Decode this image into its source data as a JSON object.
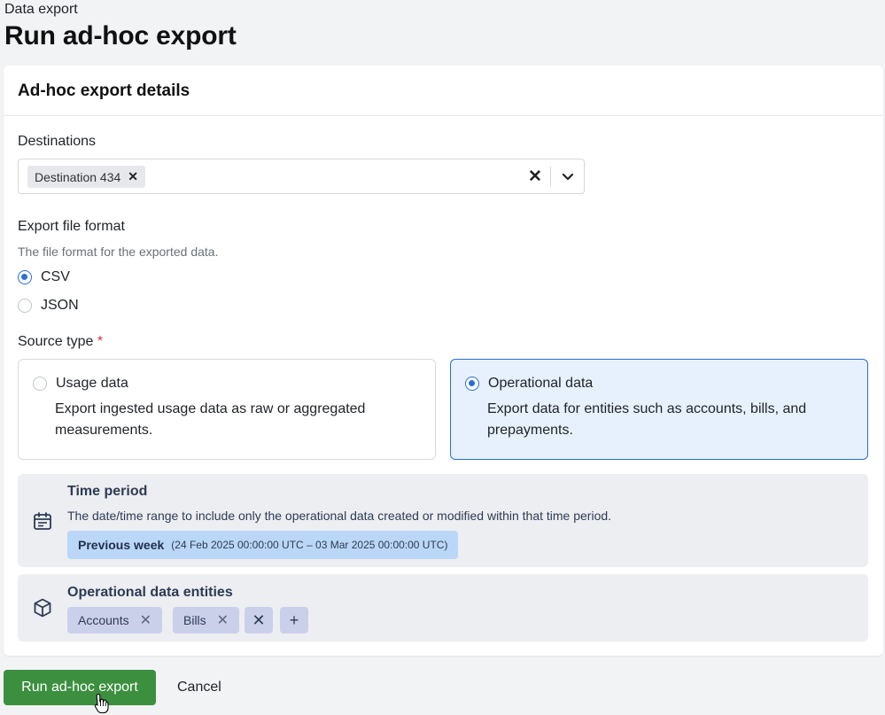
{
  "breadcrumb": "Data export",
  "page_title": "Run ad-hoc export",
  "card": {
    "title": "Ad-hoc export details"
  },
  "destinations": {
    "label": "Destinations",
    "selected": [
      "Destination 434"
    ],
    "chip_remove_icon": "close-icon",
    "clear_icon": "close-icon",
    "toggle_icon": "chevron-down-icon"
  },
  "file_format": {
    "label": "Export file format",
    "description": "The file format for the exported data.",
    "options": [
      {
        "label": "CSV",
        "selected": true
      },
      {
        "label": "JSON",
        "selected": false
      }
    ]
  },
  "source_type": {
    "label": "Source type",
    "required_marker": "*",
    "options": [
      {
        "title": "Usage data",
        "description": "Export ingested usage data as raw or aggregated measurements.",
        "selected": false
      },
      {
        "title": "Operational data",
        "description": "Export data for entities such as accounts, bills, and prepayments.",
        "selected": true
      }
    ]
  },
  "time_period": {
    "title": "Time period",
    "description": "The date/time range to include only the operational data created or modified within that time period.",
    "selected_name": "Previous week",
    "selected_range": "(24 Feb 2025 00:00:00 UTC – 03 Mar 2025 00:00:00 UTC)",
    "icon": "calendar-icon"
  },
  "entities": {
    "title": "Operational data entities",
    "items": [
      "Accounts",
      "Bills"
    ],
    "icon": "cube-icon",
    "clear_icon": "close-icon",
    "add_icon": "plus-icon"
  },
  "actions": {
    "run_label": "Run ad-hoc export",
    "cancel_label": "Cancel"
  },
  "colors": {
    "primary_button": "#3c8f3f",
    "selection_blue": "#2a6fd6",
    "selected_card_bg": "#e6f1fd",
    "period_chip_bg": "#bad7f7",
    "entity_chip_bg": "#cbd0ea"
  }
}
